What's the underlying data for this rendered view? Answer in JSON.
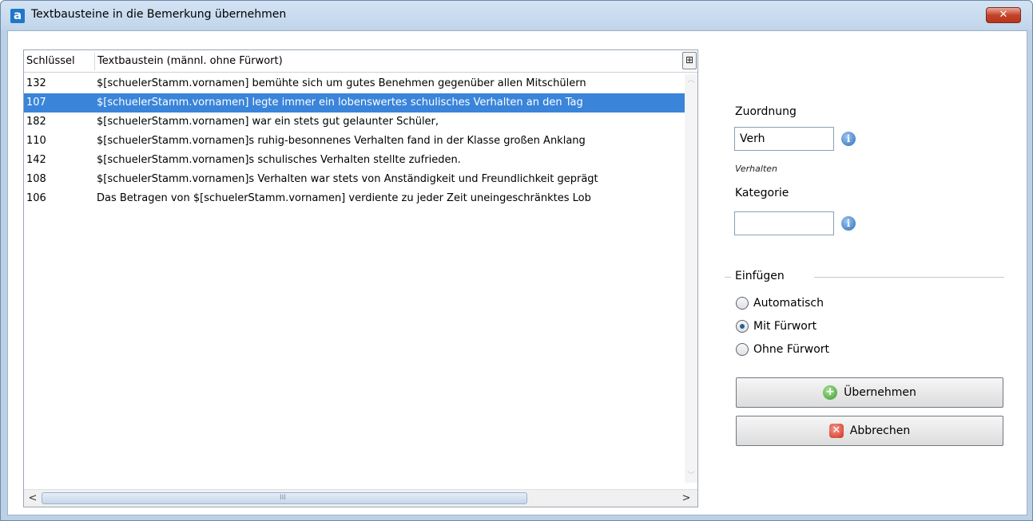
{
  "window": {
    "title": "Textbausteine in die Bemerkung übernehmen",
    "app_icon_letter": "a",
    "close_symbol": "✕"
  },
  "grid": {
    "columns": [
      "Schlüssel",
      "Textbaustein (männl. ohne Fürwort)"
    ],
    "column_chooser_symbol": "⊞",
    "rows": [
      {
        "key": "132",
        "text": "$[schuelerStamm.vornamen] bemühte sich um gutes Benehmen gegenüber allen Mitschülern"
      },
      {
        "key": "107",
        "text": "$[schuelerStamm.vornamen] legte immer ein lobenswertes schulisches Verhalten an den Tag"
      },
      {
        "key": "182",
        "text": "$[schuelerStamm.vornamen] war ein stets gut gelaunter Schüler,"
      },
      {
        "key": "110",
        "text": "$[schuelerStamm.vornamen]s ruhig-besonnenes Verhalten fand in der Klasse großen Anklang"
      },
      {
        "key": "142",
        "text": "$[schuelerStamm.vornamen]s schulisches Verhalten stellte zufrieden."
      },
      {
        "key": "108",
        "text": "$[schuelerStamm.vornamen]s Verhalten war stets von Anständigkeit und Freundlichkeit geprägt"
      },
      {
        "key": "106",
        "text": "Das Betragen von $[schuelerStamm.vornamen] verdiente zu jeder Zeit uneingeschränktes Lob"
      }
    ],
    "selected_index": 1,
    "scroll_left_symbol": "<",
    "scroll_right_symbol": ">",
    "scroll_grip": "III"
  },
  "panel": {
    "zuordnung_label": "Zuordnung",
    "zuordnung_value": "Verh",
    "zuordnung_hint": "Verhalten",
    "kategorie_label": "Kategorie",
    "kategorie_value": "",
    "info_symbol": "i",
    "group_label": "Einfügen",
    "radios": [
      {
        "label": "Automatisch",
        "checked": false
      },
      {
        "label": "Mit Fürwort",
        "checked": true
      },
      {
        "label": "Ohne Fürwort",
        "checked": false
      }
    ],
    "ok_label": "Übernehmen",
    "cancel_label": "Abbrechen",
    "ok_icon_symbol": "+",
    "cancel_icon_symbol": "✕"
  }
}
